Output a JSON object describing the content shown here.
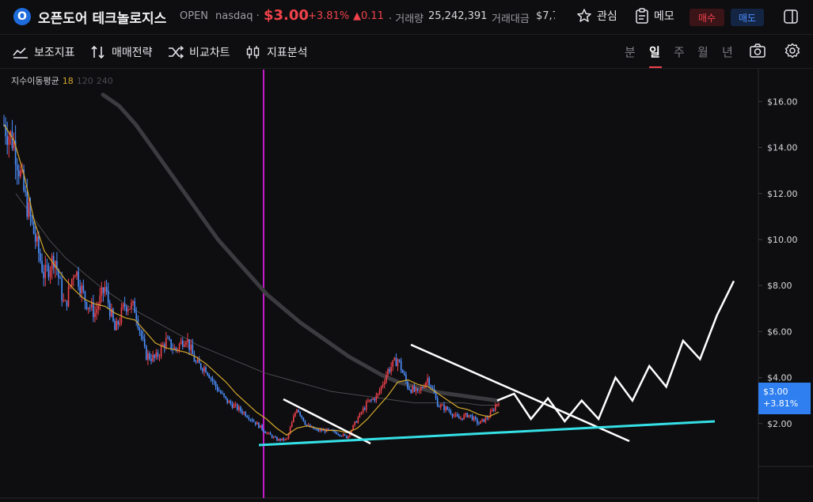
{
  "header": {
    "logo_letter": "O",
    "stock_name": "오픈도어 테크놀로지스",
    "ticker": "OPEN",
    "exchange": "nasdaq ·",
    "price": "$3.00",
    "change_pct": "+3.81%",
    "change_abs": "▲0.11",
    "volume_label": "· 거래량",
    "volume_value": "25,242,391",
    "amount_label": "거래대금",
    "amount_value": "$7,7",
    "watch_label": "관심",
    "memo_label": "메모",
    "buy_label": "매수",
    "sell_label": "매도"
  },
  "toolbar": {
    "indicator_label": "보조지표",
    "strategy_label": "매매전략",
    "compare_label": "비교차트",
    "analysis_label": "지표분석",
    "periods": [
      "분",
      "일",
      "주",
      "월",
      "년"
    ],
    "active_period": "일"
  },
  "indicator": {
    "name": "지수이동평균",
    "ma1": "18",
    "ma2": "120",
    "ma3": "240"
  },
  "price_tag": {
    "price": "$3.00",
    "pct": "+3.81%"
  },
  "colors": {
    "up": "#f0424b",
    "down": "#4d8fff",
    "ma18": "#d4a72c",
    "trend_cyan": "#35e0e6",
    "vertical_marker": "#c41ccb",
    "accent_blue": "#2f7ff0"
  },
  "chart_data": {
    "type": "line",
    "yaxis_ticks": [
      "$16.00",
      "$14.00",
      "$12.00",
      "$10.00",
      "$8.00",
      "$6.00",
      "$4.00",
      "$2.00"
    ],
    "ylim": [
      0,
      17
    ],
    "series": [
      {
        "values": [
          15.0,
          14.2,
          12.0,
          10.2,
          8.4,
          9.3,
          7.0,
          8.8,
          7.4,
          6.8,
          7.9,
          6.0,
          7.2,
          7.0,
          5.0,
          4.8,
          5.6,
          5.2,
          5.8,
          4.6,
          4.4,
          3.6,
          3.0,
          2.7,
          2.4,
          2.0,
          1.6,
          1.3,
          1.3,
          2.7,
          1.9,
          1.7,
          1.7,
          1.6,
          1.4,
          2.2,
          2.9,
          3.2,
          4.3,
          4.8,
          3.6,
          3.3,
          4.0,
          2.8,
          2.6,
          2.2,
          2.4,
          2.0,
          2.3,
          3.0
        ]
      }
    ],
    "ma_series": [
      {
        "name": "18",
        "values": [
          15.0,
          14.3,
          12.8,
          10.8,
          9.5,
          8.9,
          8.3,
          7.8,
          7.4,
          7.2,
          7.1,
          6.8,
          6.6,
          6.5,
          6.0,
          5.5,
          5.3,
          5.2,
          5.1,
          4.9,
          4.6,
          4.2,
          3.8,
          3.3,
          2.9,
          2.5,
          2.2,
          1.8,
          1.5,
          1.8,
          1.9,
          1.8,
          1.7,
          1.7,
          1.6,
          1.8,
          2.2,
          2.7,
          3.2,
          3.8,
          3.9,
          3.7,
          3.6,
          3.3,
          3.0,
          2.7,
          2.6,
          2.4,
          2.3,
          2.5
        ]
      },
      {
        "name": "120",
        "values": [
          12.0,
          11.0,
          10.0,
          9.2,
          8.6,
          8.0,
          7.5,
          7.0,
          6.6,
          6.2,
          5.8,
          5.4,
          5.1,
          4.8,
          4.5,
          4.2,
          4.0,
          3.8,
          3.6,
          3.4,
          3.3,
          3.2,
          3.1,
          3.0,
          2.9,
          2.9,
          2.9,
          2.9,
          2.8,
          2.8
        ]
      },
      {
        "name": "240",
        "values": [
          16.3,
          15.8,
          15.0,
          14.0,
          13.0,
          12.0,
          11.0,
          10.0,
          9.2,
          8.4,
          7.6,
          7.0,
          6.4,
          5.9,
          5.4,
          4.9,
          4.5,
          4.1,
          3.8,
          3.6,
          3.4,
          3.3,
          3.2,
          3.1,
          3.0
        ]
      }
    ],
    "drawings": {
      "support_line": [
        [
          0.0,
          1.0
        ],
        [
          1.0,
          2.0
        ]
      ],
      "forecast_path": [
        3.0,
        3.3,
        2.2,
        3.1,
        2.1,
        3.0,
        2.2,
        4.0,
        3.0,
        4.5,
        3.6,
        5.6,
        4.8,
        6.7,
        8.2
      ]
    }
  }
}
